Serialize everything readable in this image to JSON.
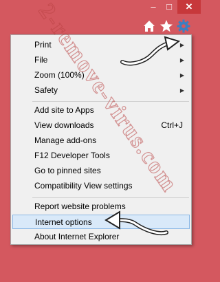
{
  "window": {
    "minimize_glyph": "–",
    "maximize_glyph": "□",
    "close_glyph": "✕"
  },
  "toolbar": {
    "icons": [
      "home-icon",
      "star-icon",
      "gear-icon"
    ]
  },
  "menu": {
    "items": [
      {
        "label": "Print",
        "has_submenu": true
      },
      {
        "label": "File",
        "has_submenu": true
      },
      {
        "label": "Zoom (100%)",
        "has_submenu": true
      },
      {
        "label": "Safety",
        "has_submenu": true
      },
      {
        "label": "Add site to Apps"
      },
      {
        "label": "View downloads",
        "shortcut": "Ctrl+J"
      },
      {
        "label": "Manage add-ons"
      },
      {
        "label": "F12 Developer Tools"
      },
      {
        "label": "Go to pinned sites"
      },
      {
        "label": "Compatibility View settings"
      },
      {
        "label": "Report website problems"
      },
      {
        "label": "Internet options",
        "highlighted": true
      },
      {
        "label": "About Internet Explorer"
      }
    ],
    "submenu_glyph": "▶"
  },
  "watermark": {
    "text": "2-remove-virus.com"
  },
  "colors": {
    "titlebar": "#d4585f",
    "close_button": "#c7383b",
    "menu_background": "#f0f0f0",
    "highlight": "#d9e9f9",
    "gear": "#3c7fc1"
  }
}
